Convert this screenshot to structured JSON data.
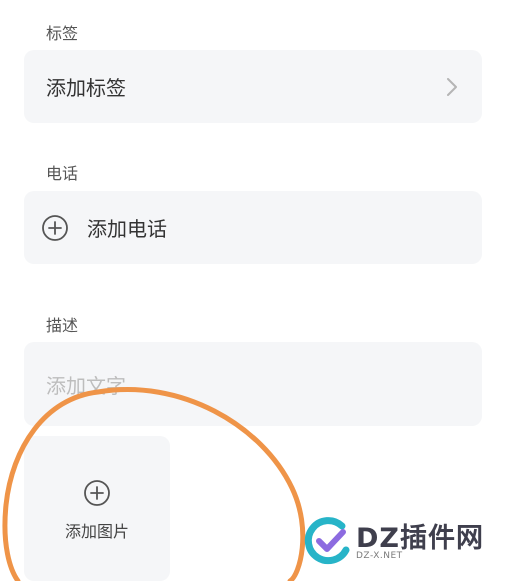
{
  "tags": {
    "label": "标签",
    "value": "添加标签"
  },
  "phone": {
    "label": "电话",
    "add_label": "添加电话"
  },
  "description": {
    "label": "描述",
    "placeholder": "添加文字"
  },
  "image": {
    "add_label": "添加图片"
  },
  "annotation": {
    "color": "#ef9448"
  },
  "watermark": {
    "brand": "DZ插件网",
    "url": "DZ-X.NET"
  },
  "icons": {
    "chevron": "chevron-right-icon",
    "plus_circle": "plus-circle-icon"
  }
}
